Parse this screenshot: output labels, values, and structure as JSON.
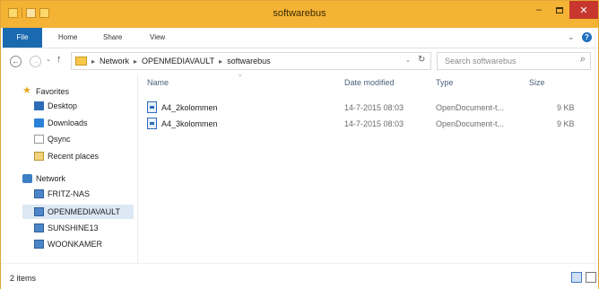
{
  "window": {
    "title": "softwarebus",
    "min_glyph": "–",
    "close_glyph": "✕"
  },
  "ribbon": {
    "tabs": [
      "File",
      "Home",
      "Share",
      "View"
    ],
    "expand_glyph": "⌄",
    "help_glyph": "?"
  },
  "address": {
    "back_glyph": "←",
    "forward_glyph": "→",
    "dropdown_glyph": "⌄",
    "up_glyph": "↑",
    "crumbs": [
      "Network",
      "OPENMEDIAVAULT",
      "softwarebus"
    ],
    "crumb_sep": "▸",
    "refresh_glyph": "↻"
  },
  "search": {
    "placeholder": "Search softwarebus",
    "icon_glyph": "⌕"
  },
  "sidebar": {
    "favorites_label": "Favorites",
    "favorites": [
      "Desktop",
      "Downloads",
      "Qsync",
      "Recent places"
    ],
    "network_label": "Network",
    "network": [
      "FRITZ-NAS",
      "OPENMEDIAVAULT",
      "SUNSHINE13",
      "WOONKAMER"
    ]
  },
  "list": {
    "columns": {
      "name": "Name",
      "date": "Date modified",
      "type": "Type",
      "size": "Size"
    },
    "sort_glyph": "^",
    "rows": [
      {
        "name": "A4_2kolommen",
        "date": "14-7-2015 08:03",
        "type": "OpenDocument-t...",
        "size": "9 KB"
      },
      {
        "name": "A4_3kolommen",
        "date": "14-7-2015 08:03",
        "type": "OpenDocument-t...",
        "size": "9 KB"
      }
    ]
  },
  "status": {
    "count": "2 items"
  },
  "colors": {
    "titlebar": "#f4b334",
    "file_tab": "#1a6ab0",
    "close_button": "#c7372d",
    "selected_nav": "#dde8f5"
  }
}
